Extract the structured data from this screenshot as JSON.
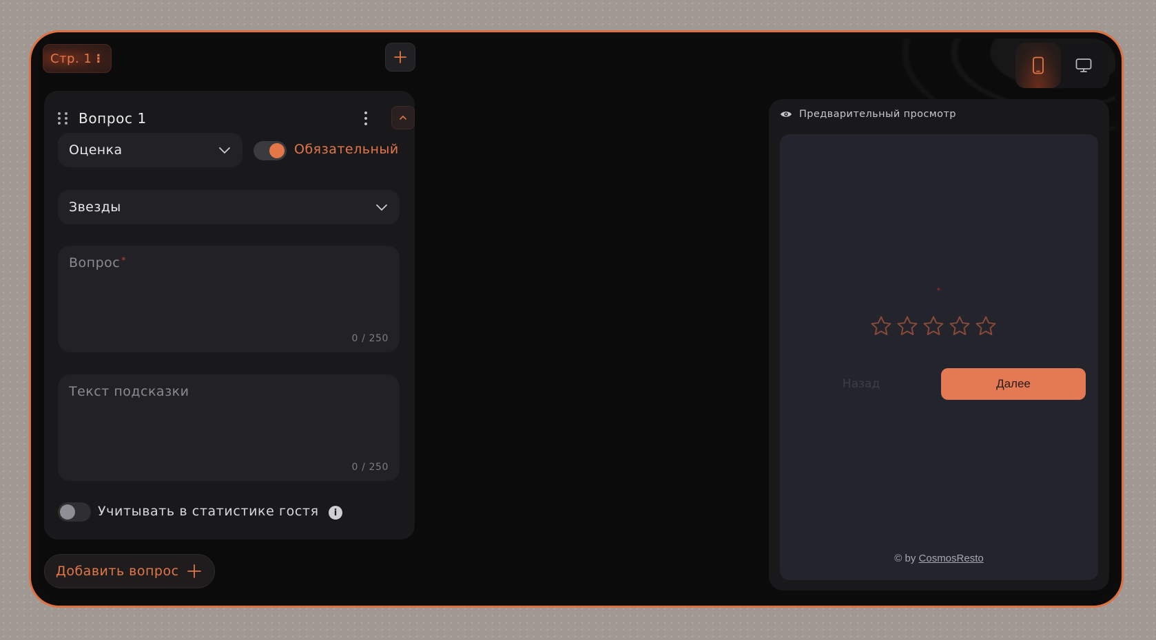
{
  "pages": {
    "current_tab_label": "Стр. 1",
    "add_page_icon": "plus-icon"
  },
  "device_switch": {
    "active": "mobile",
    "options": [
      "mobile",
      "desktop"
    ]
  },
  "question": {
    "title": "Вопрос 1",
    "type_select": {
      "value": "Оценка"
    },
    "required": {
      "label": "Обязательный",
      "on": true
    },
    "rating_style_select": {
      "value": "Звезды"
    },
    "question_field": {
      "placeholder": "Вопрос",
      "required_marker": "*",
      "counter": "0 / 250"
    },
    "hint_field": {
      "placeholder": "Текст подсказки",
      "counter": "0 / 250"
    },
    "guest_stats": {
      "label": "Учитывать в статистике гостя",
      "on": false,
      "info_icon": "i"
    }
  },
  "add_question": {
    "label": "Добавить вопрос"
  },
  "preview": {
    "title": "Предварительный просмотр",
    "required_marker": "*",
    "stars_count": 5,
    "back_label": "Назад",
    "next_label": "Далее",
    "footer_prefix": "© by",
    "footer_link": "CosmosResto"
  },
  "colors": {
    "accent": "#e47648",
    "frame_border": "#e0703f",
    "card_bg": "#19191b",
    "field_bg": "#222226",
    "preview_screen_bg": "#24252c",
    "next_button_bg": "#e37a54"
  }
}
